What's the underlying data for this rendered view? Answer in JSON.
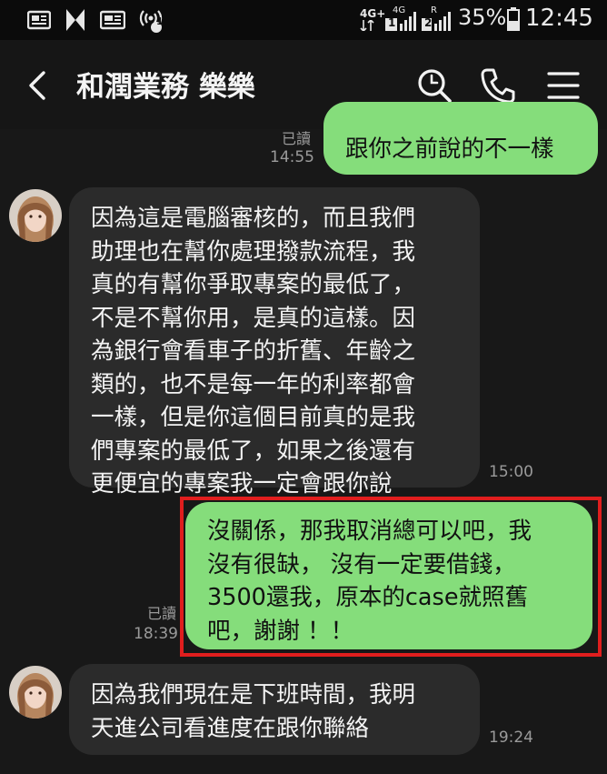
{
  "status_bar": {
    "network_4g": "4G+",
    "network_4g_small": "4G",
    "sim1": "1",
    "sim2": "2",
    "roaming": "R",
    "battery": "35%",
    "time": "12:45",
    "icons": [
      "news-icon",
      "pinwheel-icon",
      "news-alt-icon",
      "wifi-calling-icon",
      "signal-icon",
      "battery-icon"
    ]
  },
  "header": {
    "title": "和潤業務 樂樂",
    "icons": [
      "back-icon",
      "search-icon",
      "phone-icon",
      "menu-icon"
    ]
  },
  "messages": [
    {
      "side": "out",
      "text": "跟你之前說的不一樣",
      "read": "已讀",
      "time": "14:55"
    },
    {
      "side": "in",
      "text": "因為這是電腦審核的，而且我們\n助理也在幫你處理撥款流程，我\n真的有幫你爭取專案的最低了，\n不是不幫你用，是真的這樣。因\n為銀行會看車子的折舊、年齡之\n類的，也不是每一年的利率都會\n一樣，但是你這個目前真的是我\n們專案的最低了，如果之後還有\n更便宜的專案我一定會跟你說",
      "time": "15:00"
    },
    {
      "side": "out",
      "text": "沒關係，那我取消總可以吧，我\n沒有很缺， 沒有一定要借錢，\n3500還我，原本的case就照舊\n吧，謝謝 ！！",
      "read": "已讀",
      "time": "18:39",
      "highlighted": true
    },
    {
      "side": "in",
      "text": "因為我們現在是下班時間，我明\n天進公司看進度在跟你聯絡",
      "time": "19:24"
    }
  ],
  "colors": {
    "background": "#181818",
    "incoming_bubble": "#2b2b2b",
    "outgoing_bubble": "#85dd7b",
    "highlight_border": "#e01e1e"
  }
}
